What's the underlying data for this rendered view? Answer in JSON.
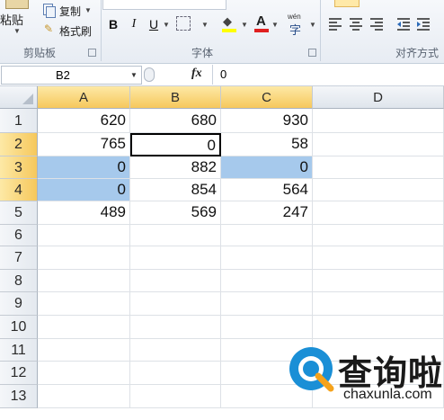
{
  "ribbon": {
    "paste_label": "粘贴",
    "copy_label": "复制",
    "format_painter_label": "格式刷",
    "clipboard_group": "剪贴板",
    "bold": "B",
    "italic": "I",
    "underline": "U",
    "font_color_glyph": "A",
    "phonetic_glyph": "wén",
    "font_group": "字体",
    "align_group": "对齐方式"
  },
  "formula_bar": {
    "name_box": "B2",
    "fx": "fx",
    "value": "0"
  },
  "sheet": {
    "columns": [
      "A",
      "B",
      "C",
      "D"
    ],
    "rows": [
      {
        "num": "1",
        "cells": [
          "620",
          "680",
          "930",
          ""
        ]
      },
      {
        "num": "2",
        "cells": [
          "765",
          "0",
          "58",
          ""
        ]
      },
      {
        "num": "3",
        "cells": [
          "0",
          "882",
          "0",
          ""
        ]
      },
      {
        "num": "4",
        "cells": [
          "0",
          "854",
          "564",
          ""
        ]
      },
      {
        "num": "5",
        "cells": [
          "489",
          "569",
          "247",
          ""
        ]
      },
      {
        "num": "6",
        "cells": [
          "",
          "",
          "",
          ""
        ]
      },
      {
        "num": "7",
        "cells": [
          "",
          "",
          "",
          ""
        ]
      },
      {
        "num": "8",
        "cells": [
          "",
          "",
          "",
          ""
        ]
      },
      {
        "num": "9",
        "cells": [
          "",
          "",
          "",
          ""
        ]
      },
      {
        "num": "10",
        "cells": [
          "",
          "",
          "",
          ""
        ]
      },
      {
        "num": "11",
        "cells": [
          "",
          "",
          "",
          ""
        ]
      },
      {
        "num": "12",
        "cells": [
          "",
          "",
          "",
          ""
        ]
      },
      {
        "num": "13",
        "cells": [
          "",
          "",
          "",
          ""
        ]
      }
    ],
    "active_cell": "B2",
    "highlighted_cells": [
      "A3",
      "C3",
      "A4"
    ],
    "highlight_color": "#a6c9ec",
    "selected_header_color": "#f6c85c"
  },
  "watermark": {
    "name": "查询啦",
    "url": "chaxunla.com",
    "icon": "magnifier-logo-icon"
  }
}
